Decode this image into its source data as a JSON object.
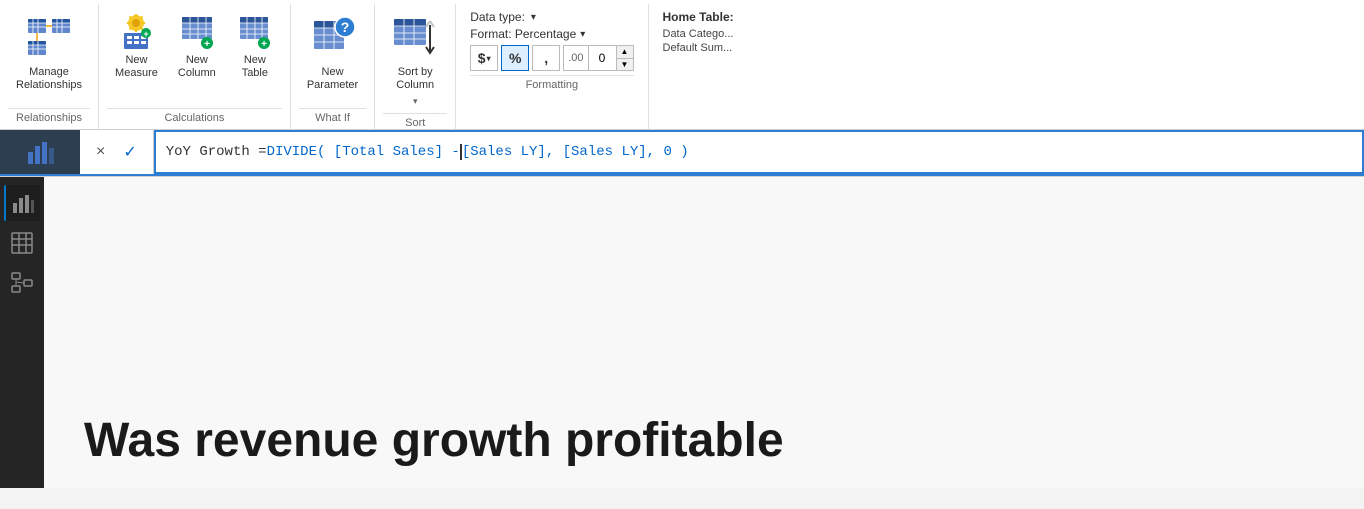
{
  "ribbon": {
    "groups": [
      {
        "id": "relationships",
        "label": "Relationships",
        "items": [
          {
            "id": "manage-relationships",
            "label": "Manage\nRelationships",
            "size": "large",
            "icon": "manage-relationships-icon"
          }
        ]
      },
      {
        "id": "calculations",
        "label": "Calculations",
        "items": [
          {
            "id": "new-measure",
            "label": "New\nMeasure",
            "size": "small",
            "icon": "new-measure-icon"
          },
          {
            "id": "new-column",
            "label": "New\nColumn",
            "size": "small",
            "icon": "new-column-icon"
          },
          {
            "id": "new-table",
            "label": "New\nTable",
            "size": "small",
            "icon": "new-table-icon"
          }
        ]
      },
      {
        "id": "what-if",
        "label": "What If",
        "items": [
          {
            "id": "new-parameter",
            "label": "New\nParameter",
            "size": "large",
            "icon": "new-parameter-icon"
          }
        ]
      },
      {
        "id": "sort",
        "label": "Sort",
        "items": [
          {
            "id": "sort-by-column",
            "label": "Sort by\nColumn",
            "size": "large",
            "icon": "sort-by-column-icon"
          }
        ]
      },
      {
        "id": "formatting",
        "label": "Formatting",
        "data_type_label": "Data type:",
        "format_label": "Format: Percentage",
        "buttons": [
          "$",
          "%",
          ",",
          ".00"
        ],
        "decimal_value": "0"
      },
      {
        "id": "home-table",
        "label": "Home Table",
        "items": [
          "Home Table:",
          "Data Catego...",
          "Default Sum..."
        ]
      }
    ]
  },
  "formula_bar": {
    "cancel_label": "×",
    "confirm_label": "✓",
    "formula_prefix": "YoY Growth = DIVIDE( [Total Sales] -",
    "formula_suffix": "[Sales LY], [Sales LY], 0 )"
  },
  "sidebar": {
    "items": [
      {
        "id": "chart-view",
        "icon": "chart-icon",
        "active": true
      },
      {
        "id": "table-view",
        "icon": "table-icon",
        "active": false
      },
      {
        "id": "model-view",
        "icon": "model-icon",
        "active": false
      }
    ]
  },
  "content": {
    "title": "Was revenue growth profitable"
  }
}
